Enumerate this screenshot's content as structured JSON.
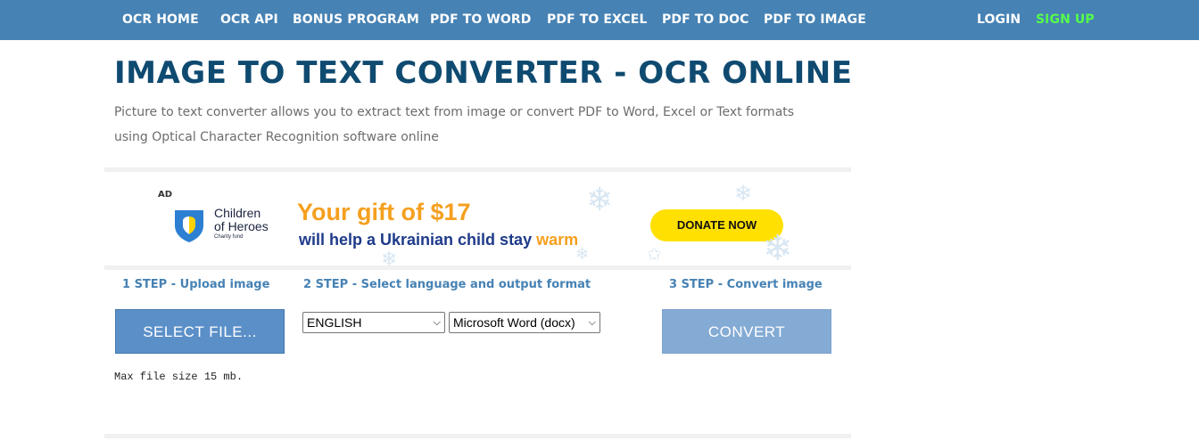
{
  "nav": {
    "items": [
      {
        "label": "OCR HOME"
      },
      {
        "label": "OCR API"
      },
      {
        "label": "BONUS PROGRAM"
      },
      {
        "label": "PDF TO WORD"
      },
      {
        "label": "PDF TO EXCEL"
      },
      {
        "label": "PDF TO DOC"
      },
      {
        "label": "PDF TO IMAGE"
      }
    ],
    "login": "LOGIN",
    "signup": "SIGN UP"
  },
  "header": {
    "title": "IMAGE TO TEXT CONVERTER - OCR ONLINE",
    "description": "Picture to text converter allows you to extract text from image or convert PDF to Word, Excel or Text formats using Optical Character Recognition software online"
  },
  "ad": {
    "label": "AD",
    "org_name_line1": "Children",
    "org_name_line2": "of Heroes",
    "org_sub": "Charity fund",
    "headline": "Your gift of $17",
    "subline_main": "will help a Ukrainian child stay ",
    "subline_accent": "warm",
    "donate": "DONATE NOW"
  },
  "steps": {
    "step1": {
      "title": "1 STEP - Upload image",
      "button": "SELECT FILE..."
    },
    "step2": {
      "title": "2 STEP - Select language and output format",
      "language": "ENGLISH",
      "format": "Microsoft Word (docx)"
    },
    "step3": {
      "title": "3 STEP - Convert image",
      "button": "CONVERT"
    },
    "max_size": "Max file size 15 mb."
  },
  "colors": {
    "navbar": "#4682b4",
    "title": "#0f4a70",
    "signup": "#56ff4a",
    "accent": "#f5a01f",
    "donate": "#ffe000"
  }
}
